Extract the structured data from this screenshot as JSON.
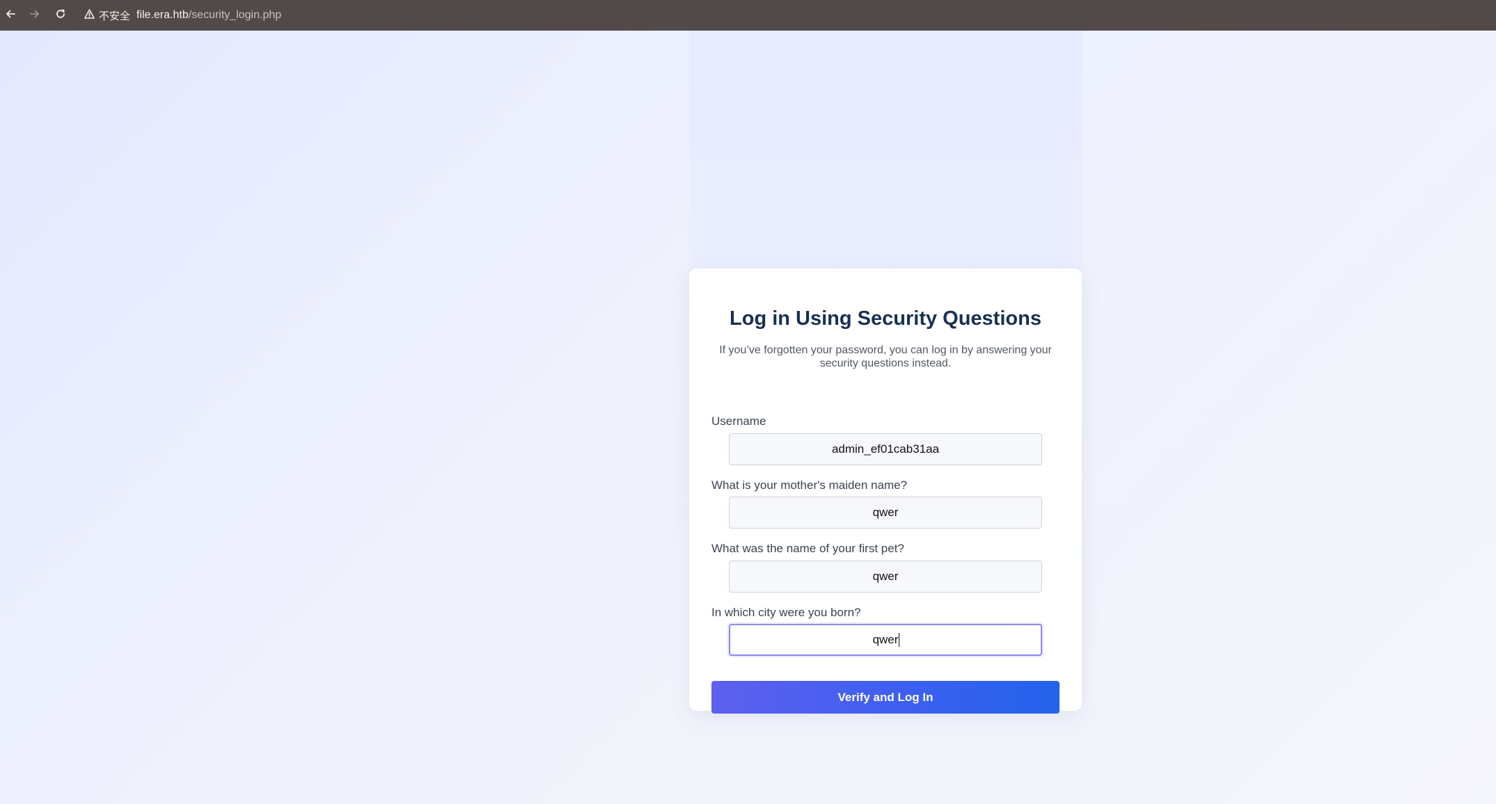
{
  "browser": {
    "security_label": "不安全",
    "url_host": "file.era.htb",
    "url_path": "/security_login.php"
  },
  "page": {
    "title": "Log in Using Security Questions",
    "subtitle": "If you’ve forgotten your password, you can log in by answering your security questions instead."
  },
  "form": {
    "fields": [
      {
        "label": "Username",
        "value": "admin_ef01cab31aa"
      },
      {
        "label": "What is your mother's maiden name?",
        "value": "qwer"
      },
      {
        "label": "What was the name of your first pet?",
        "value": "qwer"
      },
      {
        "label": "In which city were you born?",
        "value": "qwer"
      }
    ],
    "submit_label": "Verify and Log In"
  },
  "icons": {
    "back": "arrow-left-icon",
    "forward": "arrow-right-icon",
    "reload": "refresh-icon",
    "warning": "warning-triangle-icon"
  },
  "colors": {
    "browser_bar": "#524a49",
    "title": "#173153",
    "button_gradient_start": "#5f60ef",
    "button_gradient_end": "#2363eb"
  }
}
